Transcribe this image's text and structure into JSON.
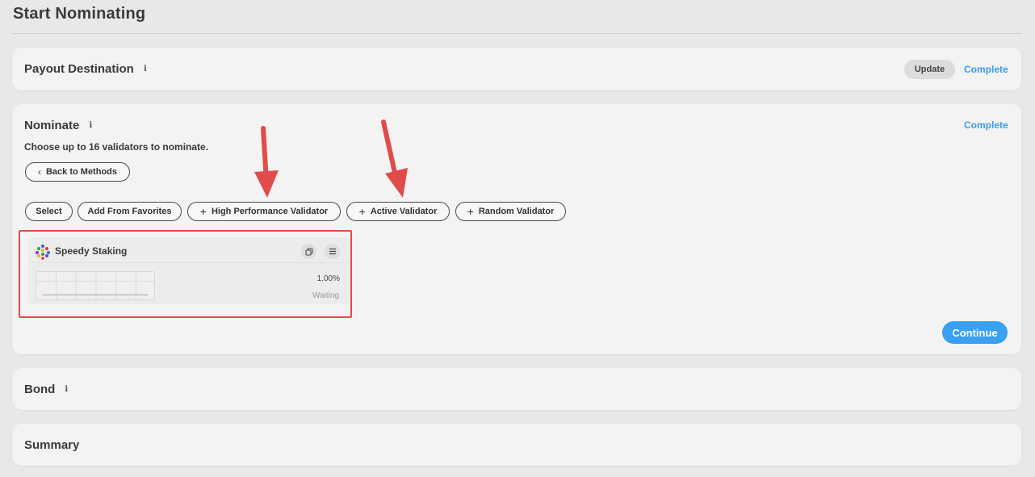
{
  "page": {
    "title": "Start Nominating"
  },
  "payout": {
    "title": "Payout Destination",
    "info_icon": "i",
    "update_label": "Update",
    "status": "Complete"
  },
  "nominate": {
    "title": "Nominate",
    "info_icon": "i",
    "status": "Complete",
    "subtitle": "Choose up to 16 validators to nominate.",
    "back_label": "Back to Methods",
    "actions": {
      "select": "Select",
      "add_favorites": "Add From Favorites",
      "high_performance": "High Performance Validator",
      "active": "Active Validator",
      "random": "Random Validator"
    },
    "validator": {
      "name": "Speedy Staking",
      "commission": "1.00%",
      "status": "Waiting",
      "copy_icon": "copy-icon",
      "menu_icon": "menu-icon"
    },
    "continue_label": "Continue"
  },
  "bond": {
    "title": "Bond",
    "info_icon": "i"
  },
  "summary": {
    "title": "Summary"
  },
  "colors": {
    "accent": "#3aa0f2",
    "annotation": "#e14b4b"
  }
}
